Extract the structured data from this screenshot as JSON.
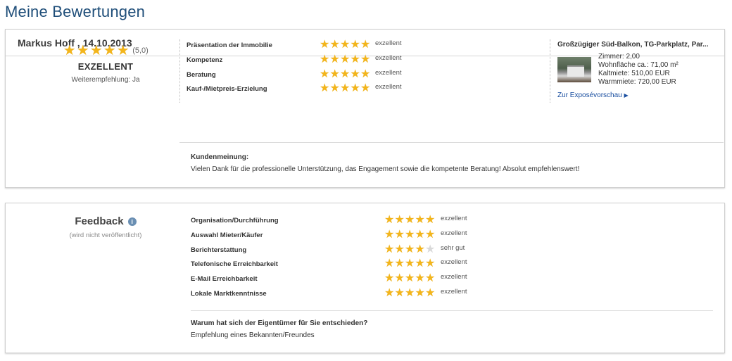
{
  "page": {
    "title": "Meine Bewertungen"
  },
  "review": {
    "header": "Markus Hoff , 14.10.2013",
    "overall": {
      "stars": 5,
      "score_text": "(5,0)",
      "label": "EXZELLENT",
      "recommendation": "Weiterempfehlung: Ja"
    },
    "criteria": [
      {
        "label": "Präsentation der Immobilie",
        "stars": 5,
        "text": "exzellent"
      },
      {
        "label": "Kompetenz",
        "stars": 5,
        "text": "exzellent"
      },
      {
        "label": "Beratung",
        "stars": 5,
        "text": "exzellent"
      },
      {
        "label": "Kauf-/Mietpreis-Erzielung",
        "stars": 5,
        "text": "exzellent"
      }
    ],
    "listing": {
      "title": "Großzügiger Süd-Balkon, TG-Parkplatz, Par...",
      "facts": [
        "Zimmer: 2,00",
        "Wohnfläche ca.: 71,00 m²",
        "Kaltmiete: 510,00 EUR",
        "Warmmiete: 720,00 EUR"
      ],
      "link": "Zur Exposévorschau",
      "link_arrow": "▶"
    },
    "comment": {
      "title": "Kundenmeinung:",
      "text": "Vielen Dank für die professionelle Unterstützung, das Engagement sowie die kompetente Beratung! Absolut empfehlenswert!"
    }
  },
  "feedback": {
    "title": "Feedback",
    "info_glyph": "i",
    "note": "(wird nicht veröffentlicht)",
    "items": [
      {
        "label": "Organisation/Durchführung",
        "stars": 5,
        "text": "exzellent"
      },
      {
        "label": "Auswahl Mieter/Käufer",
        "stars": 5,
        "text": "exzellent"
      },
      {
        "label": "Berichterstattung",
        "stars": 4,
        "text": "sehr gut"
      },
      {
        "label": "Telefonische Erreichbarkeit",
        "stars": 5,
        "text": "exzellent"
      },
      {
        "label": "E-Mail Erreichbarkeit",
        "stars": 5,
        "text": "exzellent"
      },
      {
        "label": "Lokale Marktkenntnisse",
        "stars": 5,
        "text": "exzellent"
      }
    ],
    "question": "Warum hat sich der Eigentümer für Sie entschieden?",
    "answer": "Empfehlung eines Bekannten/Freundes"
  },
  "colors": {
    "title": "#1f4e79",
    "star_filled": "#f3b51b",
    "star_empty": "#d9d9d9",
    "link": "#1a4fa0"
  },
  "icons": {
    "star": "star-icon",
    "info": "info-icon",
    "arrow": "arrow-right-icon",
    "thumb": "property-thumbnail"
  }
}
